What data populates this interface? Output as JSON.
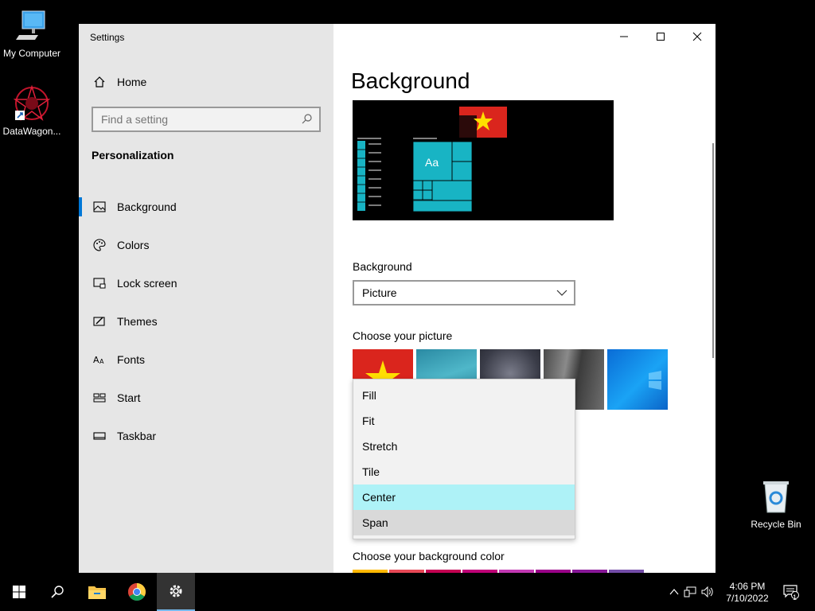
{
  "desktop": {
    "icons": [
      {
        "label": "My Computer"
      },
      {
        "label": "DataWagon..."
      },
      {
        "label": "Recycle Bin"
      }
    ]
  },
  "window": {
    "title": "Settings",
    "controls": {
      "minimize": "—",
      "maximize": "☐",
      "close": "✕"
    }
  },
  "sidebar": {
    "home_label": "Home",
    "search_placeholder": "Find a setting",
    "section_title": "Personalization",
    "items": [
      {
        "label": "Background",
        "icon": "picture-icon",
        "active": true
      },
      {
        "label": "Colors",
        "icon": "palette-icon"
      },
      {
        "label": "Lock screen",
        "icon": "lock-screen-icon"
      },
      {
        "label": "Themes",
        "icon": "themes-icon"
      },
      {
        "label": "Fonts",
        "icon": "fonts-icon"
      },
      {
        "label": "Start",
        "icon": "start-icon"
      },
      {
        "label": "Taskbar",
        "icon": "taskbar-icon"
      }
    ]
  },
  "main": {
    "page_title": "Background",
    "preview_tile_text": "Aa",
    "background_label": "Background",
    "background_value": "Picture",
    "choose_picture_label": "Choose your picture",
    "fit_options": [
      "Fill",
      "Fit",
      "Stretch",
      "Tile",
      "Center",
      "Span"
    ],
    "fit_hover": "Center",
    "fit_selected": "Span",
    "choose_color_label": "Choose your background color",
    "colors": [
      "#ffb900",
      "#e74856",
      "#c30052",
      "#bf0077",
      "#c239b3",
      "#9a0089",
      "#881798",
      "#744da9"
    ]
  },
  "taskbar": {
    "time": "4:06 PM",
    "date": "7/10/2022",
    "notification_count": "1",
    "active_app": "settings-icon"
  }
}
